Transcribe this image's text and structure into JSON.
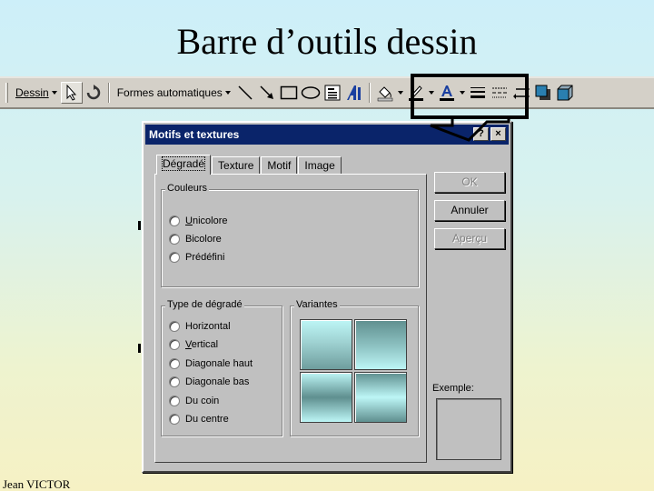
{
  "slide": {
    "title": "Barre d’outils dessin",
    "footer": "Jean VICTOR"
  },
  "toolbar": {
    "menu_label": "Dessin",
    "autoshapes_label": "Formes automatiques"
  },
  "dialog": {
    "title": "Motifs et textures",
    "close_glyph": "×",
    "help_glyph": "?",
    "tabs": [
      {
        "label": "Dégradé",
        "active": true
      },
      {
        "label": "Texture",
        "active": false
      },
      {
        "label": "Motif",
        "active": false
      },
      {
        "label": "Image",
        "active": false
      }
    ],
    "colors_group": {
      "legend": "Couleurs",
      "options": [
        "Unicolore",
        "Bicolore",
        "Prédéfini"
      ]
    },
    "gradient_type_group": {
      "legend": "Type de dégradé",
      "options": [
        "Horizontal",
        "Vertical",
        "Diagonale haut",
        "Diagonale bas",
        "Du coin",
        "Du centre"
      ]
    },
    "variants_group": {
      "legend": "Variantes"
    },
    "buttons": {
      "ok": "OK",
      "cancel": "Annuler",
      "preview": "Aperçu"
    },
    "sample_label": "Exemple:"
  },
  "colors": {
    "titlebar": "#0a246a",
    "callout": "#000000",
    "gradient_light": "#bdf6f6",
    "gradient_dark": "#5f8f8f"
  },
  "icons": [
    "dropdown-arrow-icon",
    "select-pointer-icon",
    "free-rotate-icon",
    "line-icon",
    "arrow-icon",
    "rectangle-icon",
    "oval-icon",
    "text-box-icon",
    "wordart-icon",
    "fill-color-icon",
    "line-color-icon",
    "font-color-icon",
    "line-style-icon",
    "dash-style-icon",
    "arrow-style-icon",
    "shadow-icon",
    "3d-icon"
  ]
}
